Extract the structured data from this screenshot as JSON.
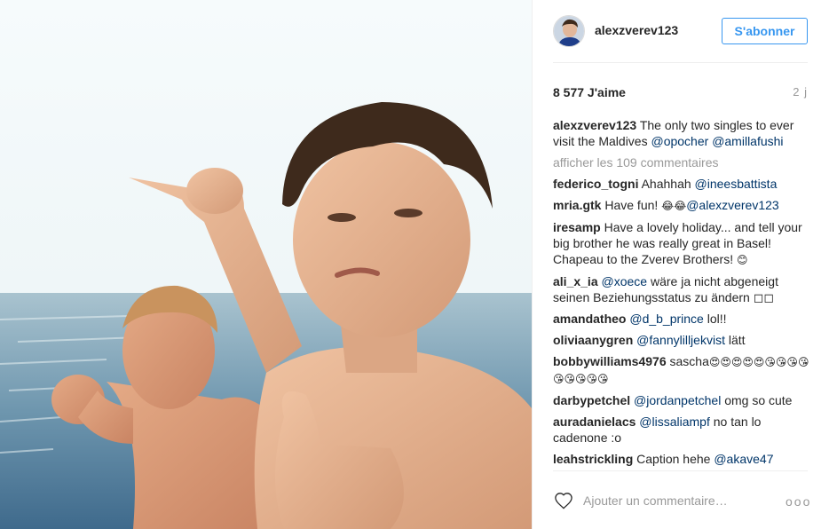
{
  "post": {
    "username": "alexzverev123",
    "follow_label": "S'abonner",
    "likes": "8 577 J'aime",
    "time": "2 j",
    "caption": {
      "user": "alexzverev123",
      "text": " The only two singles to ever visit the Maldives ",
      "mention1": "@opocher",
      "mention2": "@amillafushi"
    },
    "load_more": "afficher les 109 commentaires",
    "comment_placeholder": "Ajouter un commentaire…",
    "more_options": "ooo"
  },
  "comments": [
    {
      "user": "federico_togni",
      "pre": " Ahahhah ",
      "mention": "@ineesbattista",
      "post": ""
    },
    {
      "user": "mria.gtk",
      "pre": " Have fun! ",
      "emoji": "😂😂",
      "mention": "@alexzverev123",
      "post": ""
    },
    {
      "user": "iresamp",
      "pre": " Have a lovely holiday... and tell your big brother he was really great in Basel! Chapeau to the Zverev Brothers! ",
      "emoji": "😊",
      "post": ""
    },
    {
      "user": "ali_x_ia",
      "pre": " ",
      "mention": "@xoece",
      "post": " wäre ja nicht abgeneigt seinen Beziehungsstatus zu ändern ◻◻"
    },
    {
      "user": "amandatheo",
      "pre": " ",
      "mention": "@d_b_prince",
      "post": " lol!!"
    },
    {
      "user": "oliviaanygren",
      "pre": " ",
      "mention": "@fannylilljekvist",
      "post": " lätt"
    },
    {
      "user": "bobbywilliams4976",
      "pre": " sascha",
      "emoji": "😍😍😍😍😍😘😘😘😘😘😘😘😘😘",
      "post": ""
    },
    {
      "user": "darbypetchel",
      "pre": " ",
      "mention": "@jordanpetchel",
      "post": " omg so cute"
    },
    {
      "user": "auradanielacs",
      "pre": " ",
      "mention": "@lissaliampf",
      "post": " no tan lo cadenone :o"
    },
    {
      "user": "leahstrickling",
      "pre": " Caption hehe ",
      "mention": "@akave47",
      "post": ""
    }
  ],
  "icons": {
    "heart": "heart-outline-icon",
    "avatar": "avatar"
  },
  "colors": {
    "link_blue": "#3897f0",
    "mention": "#003569",
    "muted": "#999999"
  }
}
